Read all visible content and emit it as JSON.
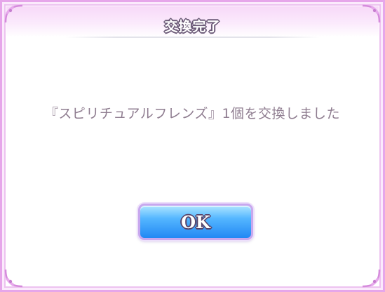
{
  "dialog": {
    "title": "交換完了",
    "message": "『スピリチュアルフレンズ』1個を交換しました",
    "ok_label": "OK"
  },
  "colors": {
    "frame": "#e6a6ea",
    "header": "#f7d9f8",
    "message_text": "#8f7d90",
    "button_top": "#b0e6ff",
    "button_bottom": "#2288f4"
  },
  "icons": {
    "corners": "corner-ornament-icon"
  }
}
